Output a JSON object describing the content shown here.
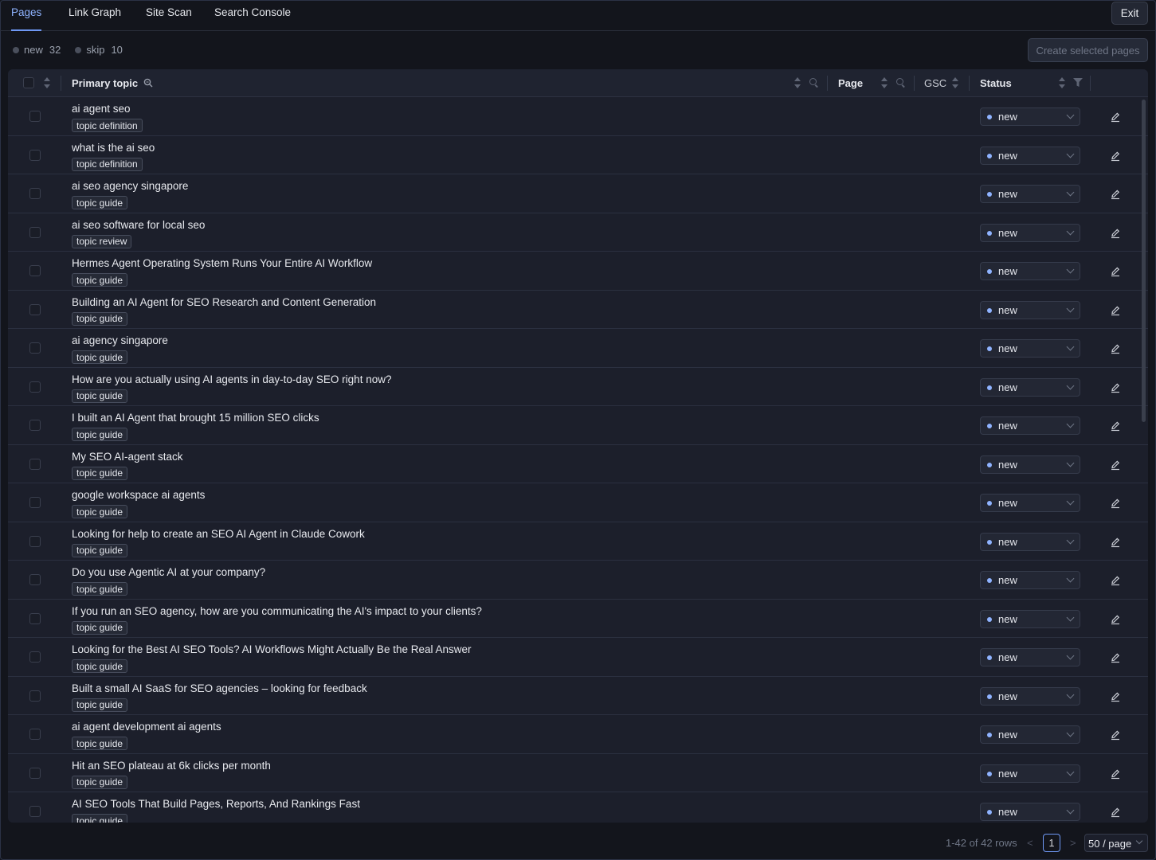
{
  "tabs": [
    {
      "label": "Pages",
      "active": true
    },
    {
      "label": "Link Graph",
      "active": false
    },
    {
      "label": "Site Scan",
      "active": false
    },
    {
      "label": "Search Console",
      "active": false
    }
  ],
  "exit_label": "Exit",
  "counts": [
    {
      "label": "new",
      "value": "32"
    },
    {
      "label": "skip",
      "value": "10"
    }
  ],
  "create_button_label": "Create selected pages",
  "columns": {
    "primary_topic": "Primary topic",
    "page": "Page",
    "gsc": "GSC",
    "status": "Status"
  },
  "rows": [
    {
      "title": "ai agent seo",
      "tag": "topic definition",
      "status": "new"
    },
    {
      "title": "what is the ai seo",
      "tag": "topic definition",
      "status": "new"
    },
    {
      "title": "ai seo agency singapore",
      "tag": "topic guide",
      "status": "new"
    },
    {
      "title": "ai seo software for local seo",
      "tag": "topic review",
      "status": "new"
    },
    {
      "title": "Hermes Agent Operating System Runs Your Entire AI Workflow",
      "tag": "topic guide",
      "status": "new"
    },
    {
      "title": "Building an AI Agent for SEO Research and Content Generation",
      "tag": "topic guide",
      "status": "new"
    },
    {
      "title": "ai agency singapore",
      "tag": "topic guide",
      "status": "new"
    },
    {
      "title": "How are you actually using AI agents in day-to-day SEO right now?",
      "tag": "topic guide",
      "status": "new"
    },
    {
      "title": "I built an AI Agent that brought 15 million SEO clicks",
      "tag": "topic guide",
      "status": "new"
    },
    {
      "title": "My SEO AI-agent stack",
      "tag": "topic guide",
      "status": "new"
    },
    {
      "title": "google workspace ai agents",
      "tag": "topic guide",
      "status": "new"
    },
    {
      "title": "Looking for help to create an SEO AI Agent in Claude Cowork",
      "tag": "topic guide",
      "status": "new"
    },
    {
      "title": "Do you use Agentic AI at your company?",
      "tag": "topic guide",
      "status": "new"
    },
    {
      "title": "If you run an SEO agency, how are you communicating the AI's impact to your clients?",
      "tag": "topic guide",
      "status": "new"
    },
    {
      "title": "Looking for the Best AI SEO Tools? AI Workflows Might Actually Be the Real Answer",
      "tag": "topic guide",
      "status": "new"
    },
    {
      "title": "Built a small AI SaaS for SEO agencies – looking for feedback",
      "tag": "topic guide",
      "status": "new"
    },
    {
      "title": "ai agent development ai agents",
      "tag": "topic guide",
      "status": "new"
    },
    {
      "title": "Hit an SEO plateau at 6k clicks per month",
      "tag": "topic guide",
      "status": "new"
    },
    {
      "title": "AI SEO Tools That Build Pages, Reports, And Rankings Fast",
      "tag": "topic guide",
      "status": "new"
    }
  ],
  "footer": {
    "range": "1-42 of 42 rows",
    "current_page": "1",
    "page_size": "50 / page"
  },
  "colors": {
    "background": "#13151c",
    "table": "#1c1f2b",
    "accent": "#6f98f5",
    "status_dot": "#8fb3ff"
  }
}
